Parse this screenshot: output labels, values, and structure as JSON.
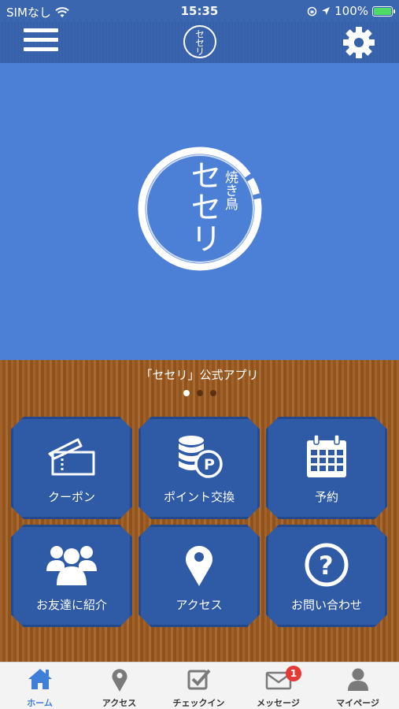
{
  "status_bar": {
    "carrier": "SIMなし",
    "time": "15:35",
    "battery": "100%",
    "battery_level": 1.0
  },
  "header": {
    "logo_text": "セセリ"
  },
  "hero": {
    "logo_text": "セセリ",
    "logo_subtext": "焼き鳥"
  },
  "carousel": {
    "caption": "「セセリ」公式アプリ",
    "page_count": 3,
    "active_index": 0
  },
  "tiles": [
    {
      "label": "クーポン",
      "icon": "ticket-icon"
    },
    {
      "label": "ポイント交換",
      "icon": "coins-icon"
    },
    {
      "label": "予約",
      "icon": "calendar-icon"
    },
    {
      "label": "お友達に紹介",
      "icon": "group-icon"
    },
    {
      "label": "アクセス",
      "icon": "map-pin-icon"
    },
    {
      "label": "お問い合わせ",
      "icon": "question-icon"
    }
  ],
  "tabbar": {
    "items": [
      {
        "label": "ホーム",
        "icon": "home-icon",
        "active": true
      },
      {
        "label": "アクセス",
        "icon": "map-pin-icon"
      },
      {
        "label": "チェックイン",
        "icon": "checkin-icon"
      },
      {
        "label": "メッセージ",
        "icon": "mail-icon",
        "badge": "1"
      },
      {
        "label": "マイページ",
        "icon": "person-icon"
      }
    ]
  },
  "colors": {
    "header": "#3a66b0",
    "hero": "#4c7fd6",
    "tile": "#2e5aa6",
    "wood": "#9a5a22",
    "active_tab": "#3f7fd8",
    "badge": "#e53935"
  }
}
